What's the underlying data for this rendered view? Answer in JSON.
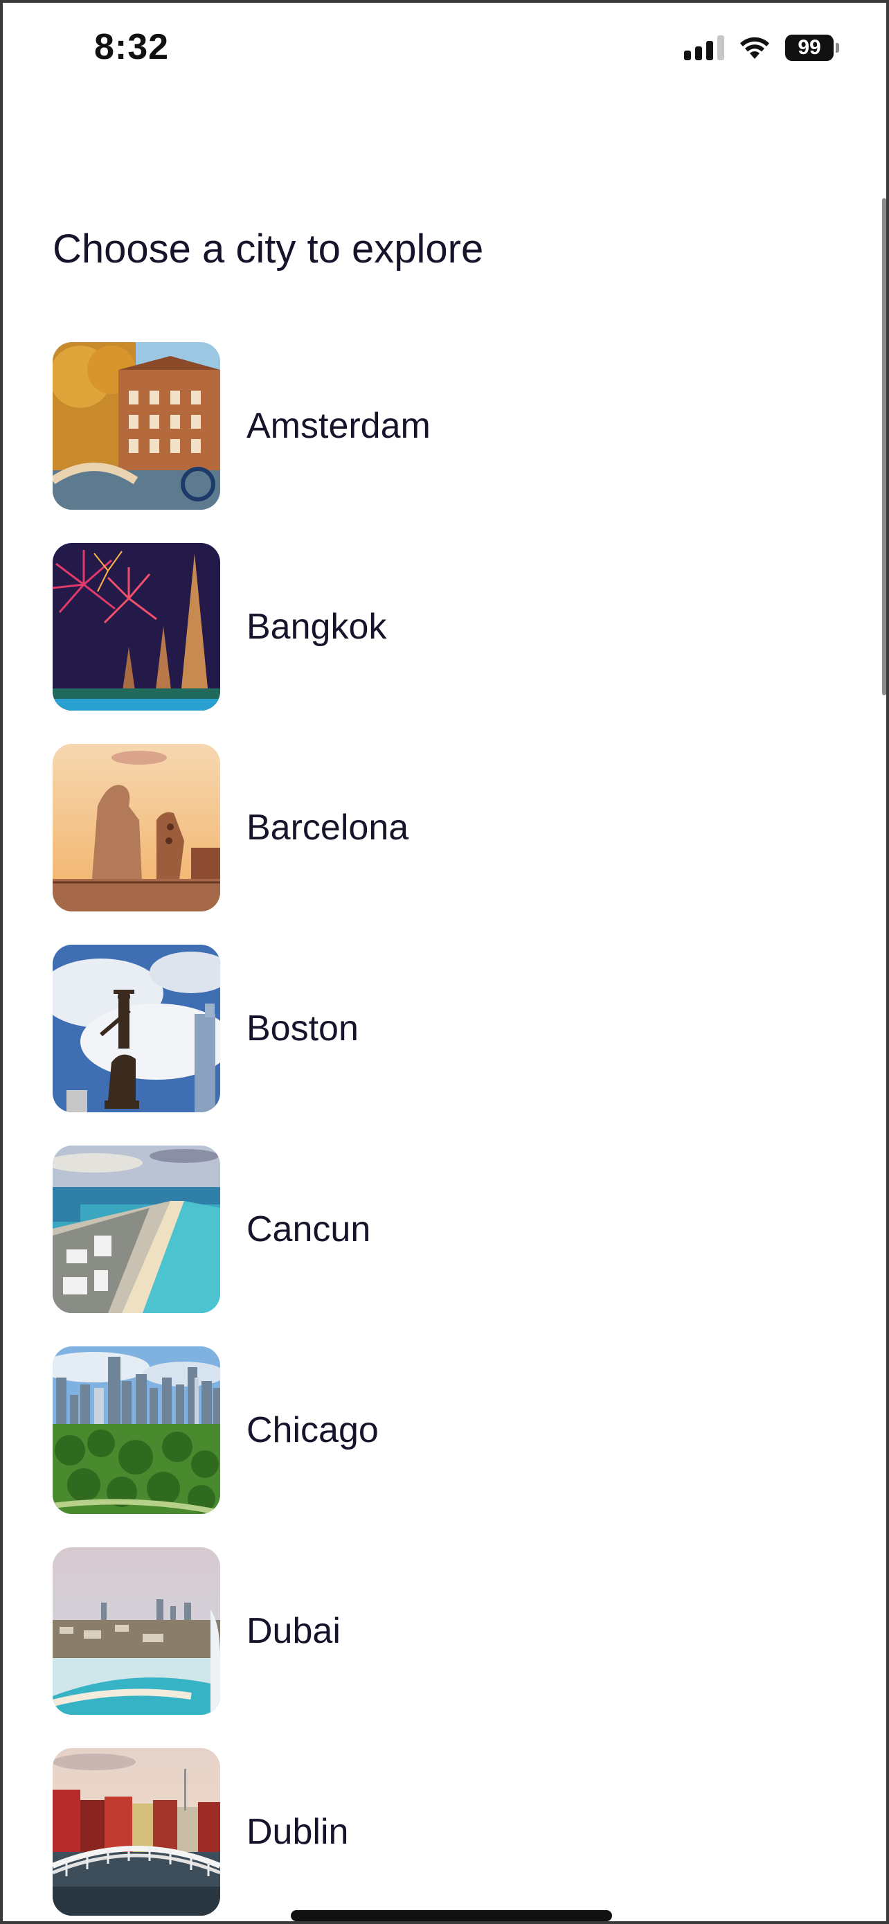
{
  "status_bar": {
    "time": "8:32",
    "battery": "99",
    "icons": [
      "signal-icon",
      "wifi-icon",
      "battery-icon"
    ]
  },
  "title": "Choose a city to explore",
  "cities": [
    {
      "name": "Amsterdam",
      "image": "amsterdam-photo"
    },
    {
      "name": "Bangkok",
      "image": "bangkok-photo"
    },
    {
      "name": "Barcelona",
      "image": "barcelona-photo"
    },
    {
      "name": "Boston",
      "image": "boston-photo"
    },
    {
      "name": "Cancun",
      "image": "cancun-photo"
    },
    {
      "name": "Chicago",
      "image": "chicago-photo"
    },
    {
      "name": "Dubai",
      "image": "dubai-photo"
    },
    {
      "name": "Dublin",
      "image": "dublin-photo"
    }
  ],
  "colors": {
    "text": "#15142a",
    "background": "#ffffff"
  }
}
